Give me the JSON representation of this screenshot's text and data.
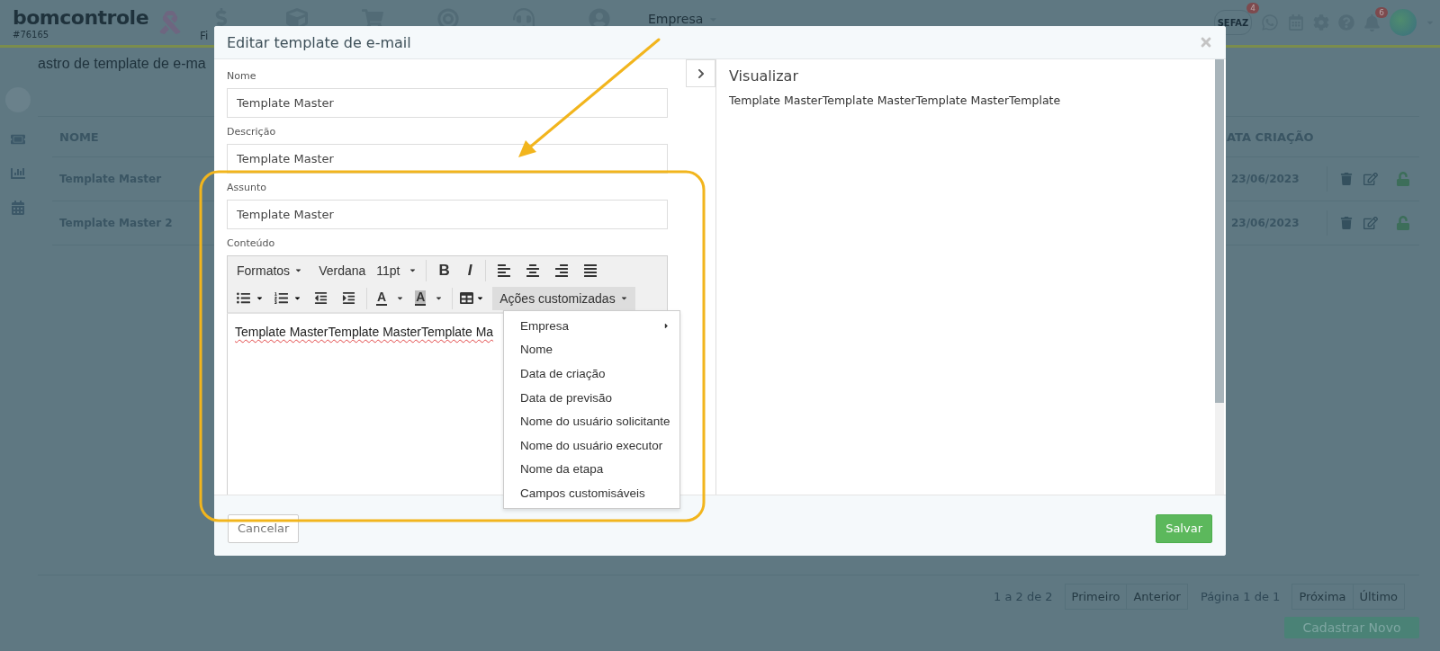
{
  "top_bar": {
    "logo": "bomcontrole",
    "account_id": "#76165",
    "nav_label": "Fi",
    "company_menu": "Empresa",
    "sefaz": {
      "label": "SEFAZ",
      "badge": "4"
    },
    "notifications_badge": "6"
  },
  "page": {
    "title": "astro de template de e-ma",
    "table": {
      "columns": [
        "NOME",
        "ATA CRIAÇÃO"
      ],
      "rows": [
        {
          "name": "Template Master",
          "created": "23/06/2023",
          "locked": false
        },
        {
          "name": "Template Master 2",
          "created": "23/06/2023",
          "locked": false
        }
      ]
    },
    "pagination": {
      "summary": "1 a 2 de 2",
      "back_buttons": [
        {
          "label": "Primeiro",
          "disabled": true
        },
        {
          "label": "Anterior",
          "disabled": true
        }
      ],
      "page_info": "Página 1 de 1",
      "next_buttons": [
        {
          "label": "Próxima",
          "disabled": true
        },
        {
          "label": "Último",
          "disabled": true
        }
      ]
    },
    "create_button": "Cadastrar Novo"
  },
  "modal": {
    "title": "Editar template de e-mail",
    "fields": [
      {
        "label": "Nome",
        "value": "Template Master"
      },
      {
        "label": "Descrição",
        "value": "Template Master"
      },
      {
        "label": "Assunto",
        "value": "Template Master"
      }
    ],
    "content_label": "Conteúdo",
    "toolbar": {
      "format_menu": "Formatos",
      "font_family": "Verdana",
      "font_size": "11pt",
      "bold": "B",
      "italic": "I",
      "text_color": "A",
      "highlight_color": "A",
      "custom_actions": {
        "label": "Ações customizadas",
        "expanded": true
      }
    },
    "editor_text": "Template MasterTemplate MasterTemplate Ma",
    "menu": [
      {
        "label": "Empresa",
        "submenu": true
      },
      {
        "label": "Nome",
        "submenu": false
      },
      {
        "label": "Data de criação",
        "submenu": false
      },
      {
        "label": "Data de previsão",
        "submenu": false
      },
      {
        "label": "Nome do usuário solicitante",
        "submenu": false
      },
      {
        "label": "Nome do usuário executor",
        "submenu": false
      },
      {
        "label": "Nome da etapa",
        "submenu": false
      },
      {
        "label": "Campos customisáveis",
        "submenu": false
      }
    ],
    "preview": {
      "title": "Visualizar",
      "text": "Template MasterTemplate MasterTemplate MasterTemplate"
    },
    "cancel_button": "Cancelar",
    "save_button": "Salvar"
  }
}
